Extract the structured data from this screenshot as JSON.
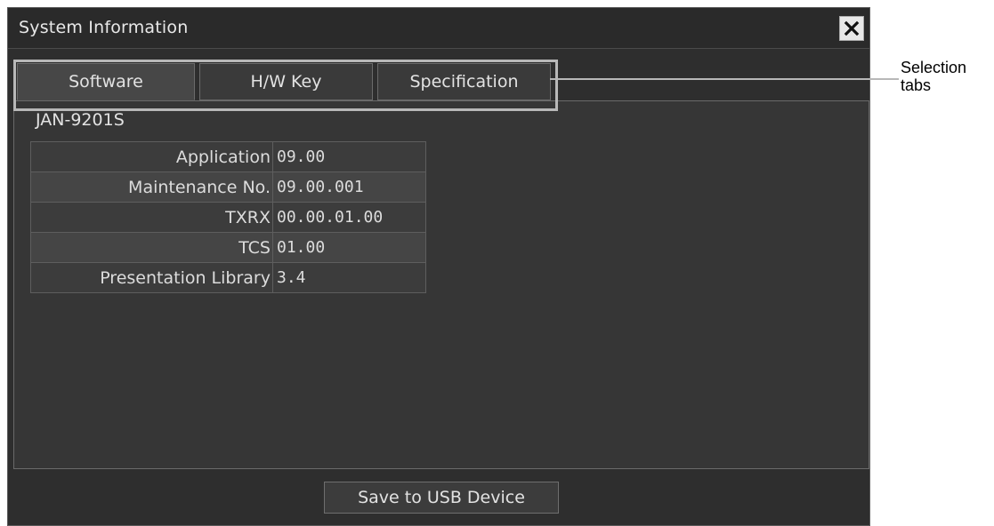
{
  "window": {
    "title": "System Information",
    "close_icon": "close-icon"
  },
  "tabs": [
    {
      "label": "Software",
      "active": true
    },
    {
      "label": "H/W Key",
      "active": false
    },
    {
      "label": "Specification",
      "active": false
    }
  ],
  "panel": {
    "model": "JAN-9201S",
    "rows": [
      {
        "key": "Application",
        "value": "09.00"
      },
      {
        "key": "Maintenance No.",
        "value": "09.00.001"
      },
      {
        "key": "TXRX",
        "value": "00.00.01.00"
      },
      {
        "key": "TCS",
        "value": "01.00"
      },
      {
        "key": "Presentation Library",
        "value": "3.4"
      }
    ]
  },
  "save_button": {
    "label": "Save to USB Device"
  },
  "callout": {
    "line1": "Selection",
    "line2": "tabs"
  }
}
